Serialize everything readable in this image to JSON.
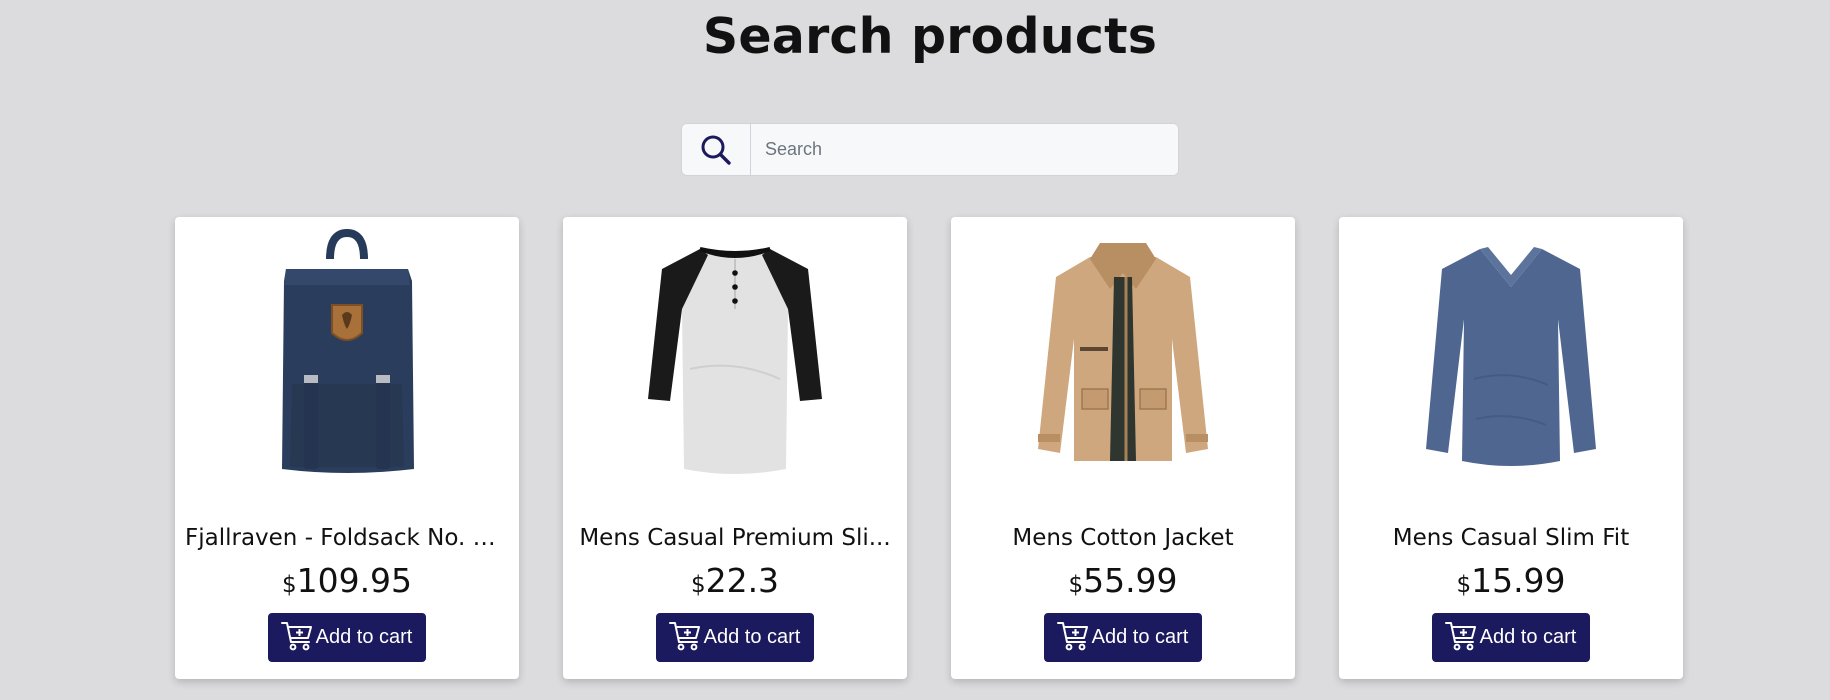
{
  "page": {
    "title": "Search products"
  },
  "search": {
    "placeholder": "Search",
    "icon": "search-icon"
  },
  "colors": {
    "accent": "#1c1a5e",
    "background": "#dcdcde",
    "card": "#ffffff"
  },
  "products": [
    {
      "title": "Fjallraven - Foldsack No. 1...",
      "currency": "$",
      "price": "109.95",
      "button": "Add to cart",
      "image": "backpack"
    },
    {
      "title": "Mens Casual Premium Sli...",
      "currency": "$",
      "price": "22.3",
      "button": "Add to cart",
      "image": "raglan-shirt"
    },
    {
      "title": "Mens Cotton Jacket",
      "currency": "$",
      "price": "55.99",
      "button": "Add to cart",
      "image": "jacket"
    },
    {
      "title": "Mens Casual Slim Fit",
      "currency": "$",
      "price": "15.99",
      "button": "Add to cart",
      "image": "long-sleeve-shirt"
    }
  ]
}
